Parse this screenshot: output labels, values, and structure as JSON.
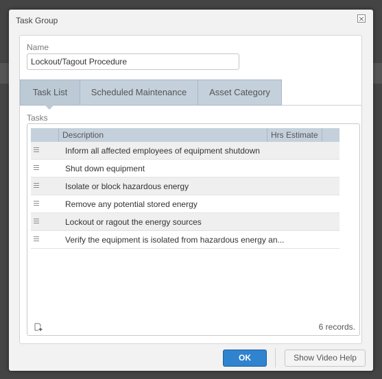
{
  "dialog": {
    "title": "Task Group",
    "close_glyph": "×"
  },
  "form": {
    "name_label": "Name",
    "name_value": "Lockout/Tagout Procedure"
  },
  "tabs": [
    {
      "label": "Task List",
      "active": true
    },
    {
      "label": "Scheduled Maintenance",
      "active": false
    },
    {
      "label": "Asset Category",
      "active": false
    }
  ],
  "tasks": {
    "label": "Tasks",
    "columns": [
      "Description",
      "Hrs Estimate"
    ],
    "rows": [
      {
        "description": "Inform all affected employees of equipment shutdown",
        "hrs_estimate": ""
      },
      {
        "description": "Shut down equipment",
        "hrs_estimate": ""
      },
      {
        "description": "Isolate or block hazardous energy",
        "hrs_estimate": ""
      },
      {
        "description": "Remove any potential stored energy",
        "hrs_estimate": ""
      },
      {
        "description": "Lockout or ragout the energy sources",
        "hrs_estimate": ""
      },
      {
        "description": "Verify the equipment is isolated from hazardous energy an...",
        "hrs_estimate": ""
      }
    ],
    "records_text": "6 records.",
    "row_icon": "drag-handle-icon",
    "add_icon": "add-task-icon"
  },
  "footer": {
    "ok_label": "OK",
    "video_help_label": "Show Video Help"
  },
  "colors": {
    "accent": "#2f83cf",
    "tab": "#c4d0db",
    "header": "#c4d0db"
  }
}
